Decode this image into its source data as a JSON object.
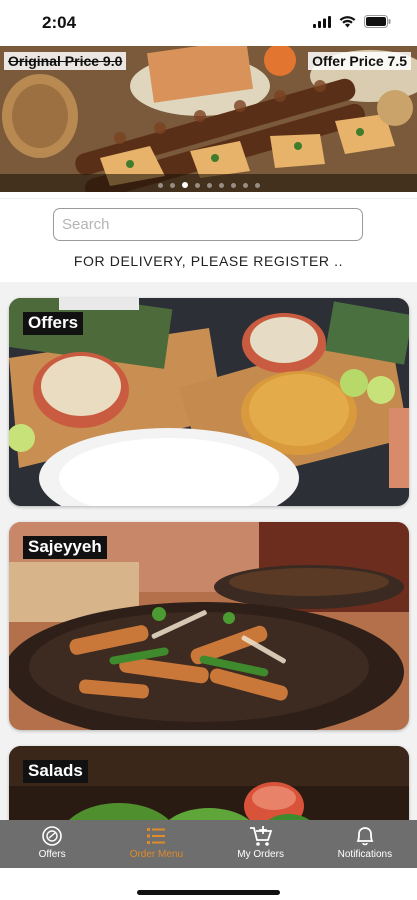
{
  "status": {
    "time": "2:04"
  },
  "banner": {
    "original_price": "Original Price 9.0",
    "offer_price": "Offer Price 7.5",
    "page_count": 9,
    "active_page": 2
  },
  "search": {
    "placeholder": "Search",
    "value": ""
  },
  "register_notice": "FOR DELIVERY, PLEASE REGISTER ..",
  "categories": [
    {
      "label": "Offers"
    },
    {
      "label": "Sajeyyeh"
    },
    {
      "label": "Salads"
    }
  ],
  "tabs": [
    {
      "label": "Offers",
      "icon": "offers-icon",
      "active": false
    },
    {
      "label": "Order Menu",
      "icon": "menu-list-icon",
      "active": true
    },
    {
      "label": "My Orders",
      "icon": "cart-icon",
      "active": false
    },
    {
      "label": "Notifications",
      "icon": "bell-icon",
      "active": false
    }
  ],
  "colors": {
    "active_tab": "#e08a2a",
    "tab_bar": "#6e6e6e"
  }
}
